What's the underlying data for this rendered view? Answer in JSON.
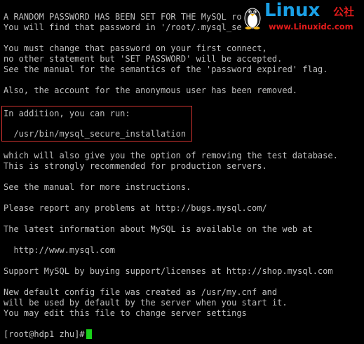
{
  "terminal": {
    "lines": [
      "A RANDOM PASSWORD HAS BEEN SET FOR THE MySQL root USER !",
      "You will find that password in '/root/.mysql_secret'.",
      "",
      "You must change that password on your first connect,",
      "no other statement but 'SET PASSWORD' will be accepted.",
      "See the manual for the semantics of the 'password expired' flag.",
      "",
      "Also, the account for the anonymous user has been removed.",
      "",
      "In addition, you can run:",
      "",
      "  /usr/bin/mysql_secure_installation",
      "",
      "which will also give you the option of removing the test database.",
      "This is strongly recommended for production servers.",
      "",
      "See the manual for more instructions.",
      "",
      "Please report any problems at http://bugs.mysql.com/",
      "",
      "The latest information about MySQL is available on the web at",
      "",
      "  http://www.mysql.com",
      "",
      "Support MySQL by buying support/licenses at http://shop.mysql.com",
      "",
      "New default config file was created as /usr/my.cnf and",
      "will be used by default by the server when you start it.",
      "You may edit this file to change server settings",
      "",
      "[root@hdp1 zhu]# "
    ]
  },
  "watermark": {
    "brand": "Linux",
    "brand_cn": "公社",
    "url": "www.Linuxidc.com"
  },
  "colors": {
    "background": "#000000",
    "text": "#c0c0c0",
    "cursor": "#19d219",
    "highlight_border": "#d0332f",
    "brand_blue": "#1aa0e6",
    "brand_red": "#e21b1b"
  }
}
